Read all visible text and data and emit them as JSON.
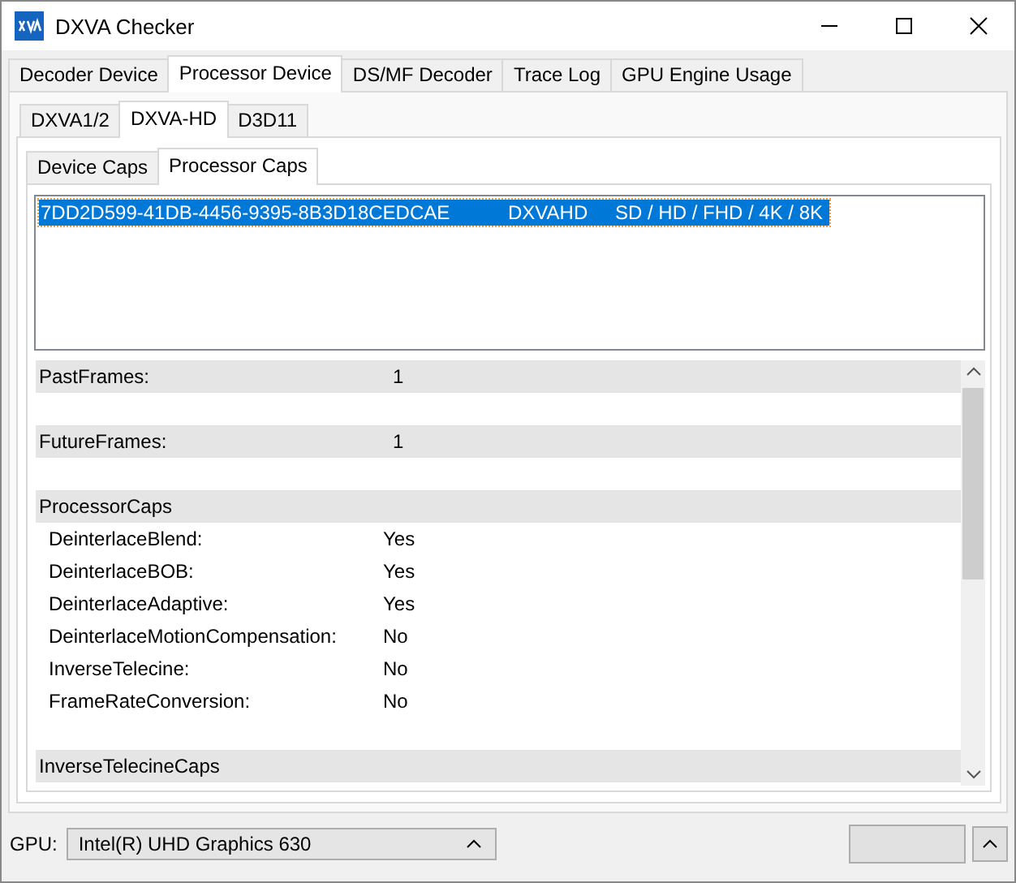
{
  "window": {
    "title": "DXVA Checker"
  },
  "tabs": [
    {
      "label": "Decoder Device",
      "selected": false
    },
    {
      "label": "Processor Device",
      "selected": true
    },
    {
      "label": "DS/MF Decoder",
      "selected": false
    },
    {
      "label": "Trace Log",
      "selected": false
    },
    {
      "label": "GPU Engine Usage",
      "selected": false
    }
  ],
  "api_tabs": [
    {
      "label": "DXVA1/2",
      "selected": false
    },
    {
      "label": "DXVA-HD",
      "selected": true
    },
    {
      "label": "D3D11",
      "selected": false
    }
  ],
  "caps_tabs": [
    {
      "label": "Device Caps",
      "selected": false
    },
    {
      "label": "Processor Caps",
      "selected": true
    }
  ],
  "processor_list": [
    {
      "guid": "7DD2D599-41DB-4456-9395-8B3D18CEDCAE",
      "type": "DXVAHD",
      "resolutions": "SD / HD / FHD / 4K / 8K",
      "selected": true
    }
  ],
  "properties": [
    {
      "title": "PastFrames:",
      "value": "1"
    },
    {
      "title": "FutureFrames:",
      "value": "1"
    },
    {
      "title": "ProcessorCaps",
      "items": [
        {
          "label": "DeinterlaceBlend:",
          "value": "Yes"
        },
        {
          "label": "DeinterlaceBOB:",
          "value": "Yes"
        },
        {
          "label": "DeinterlaceAdaptive:",
          "value": "Yes"
        },
        {
          "label": "DeinterlaceMotionCompensation:",
          "value": "No"
        },
        {
          "label": "InverseTelecine:",
          "value": "No"
        },
        {
          "label": "FrameRateConversion:",
          "value": "No"
        }
      ]
    },
    {
      "title": "InverseTelecineCaps"
    }
  ],
  "gpu": {
    "label": "GPU:",
    "value": "Intel(R) UHD Graphics 630"
  }
}
